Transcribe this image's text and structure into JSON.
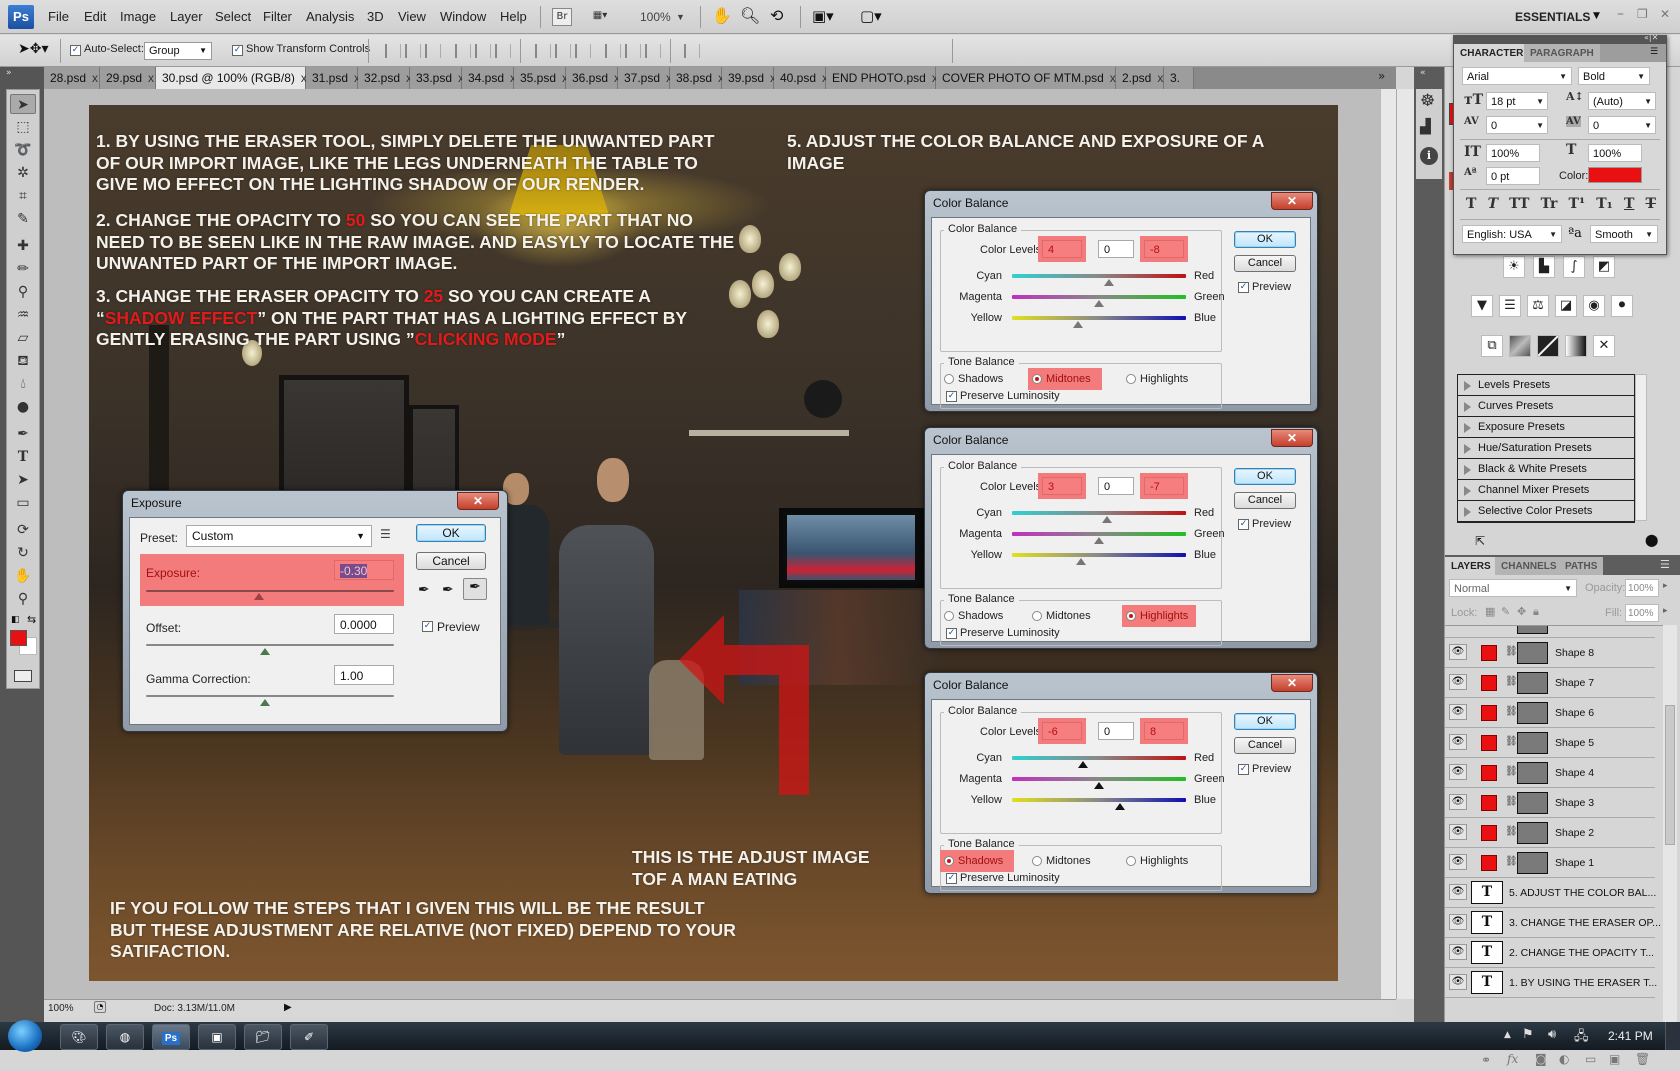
{
  "app": {
    "logo": "Ps",
    "workspace": "ESSENTIALS"
  },
  "menu": [
    "File",
    "Edit",
    "Image",
    "Layer",
    "Select",
    "Filter",
    "Analysis",
    "3D",
    "View",
    "Window",
    "Help"
  ],
  "menubar_tools": {
    "bridge": "Br",
    "zoom_level": "100%"
  },
  "window_controls": {
    "minimize": "–",
    "restore": "❐",
    "close": "✕"
  },
  "options_bar": {
    "auto_select_label": "Auto-Select:",
    "auto_select_checked": true,
    "auto_select_value": "Group",
    "show_transform_label": "Show Transform Controls",
    "show_transform_checked": true
  },
  "tabs": [
    {
      "label": "28.psd",
      "active": false
    },
    {
      "label": "29.psd",
      "active": false
    },
    {
      "label": "30.psd @ 100% (RGB/8)",
      "active": true
    },
    {
      "label": "31.psd",
      "active": false
    },
    {
      "label": "32.psd",
      "active": false
    },
    {
      "label": "33.psd",
      "active": false
    },
    {
      "label": "34.psd",
      "active": false
    },
    {
      "label": "35.psd",
      "active": false
    },
    {
      "label": "36.psd",
      "active": false
    },
    {
      "label": "37.psd",
      "active": false
    },
    {
      "label": "38.psd",
      "active": false
    },
    {
      "label": "39.psd",
      "active": false
    },
    {
      "label": "40.psd",
      "active": false
    },
    {
      "label": "END PHOTO.psd",
      "active": false
    },
    {
      "label": "COVER PHOTO OF MTM.psd",
      "active": false
    },
    {
      "label": "2.psd",
      "active": false
    },
    {
      "label": "3.",
      "active": false
    }
  ],
  "tab_close": "x",
  "tab_overflow": "»",
  "tools": [
    "move",
    "marquee",
    "lasso",
    "magic-wand",
    "crop",
    "eyedropper",
    "healing",
    "brush",
    "clone-stamp",
    "history-brush",
    "eraser",
    "paint-bucket",
    "blur",
    "dodge",
    "pen",
    "type",
    "path-select",
    "rectangle",
    "3d-rotate",
    "3d-orbit",
    "hand",
    "zoom"
  ],
  "colors": {
    "foreground": "#e81010",
    "background": "#ffffff",
    "highlight": "#f47b7b",
    "text_red": "#e11b1b"
  },
  "canvas": {
    "step1": "1. BY USING THE ERASER TOOL, SIMPLY DELETE THE UNWANTED PART\nOF OUR IMPORT IMAGE, LIKE THE LEGS UNDERNEATH THE TABLE TO\nGIVE MO EFFECT ON THE LIGHTING SHADOW OF OUR RENDER.",
    "step2_a": "2. CHANGE THE OPACITY TO ",
    "step2_red": "50",
    "step2_b": " SO YOU CAN SEE THE PART THAT NO\nNEED TO BE SEEN LIKE IN THE RAW IMAGE. AND EASYLY TO LOCATE THE\nUNWANTED PART OF THE IMPORT IMAGE.",
    "step3_a": "3. CHANGE THE ERASER OPACITY TO ",
    "step3_red1": "25",
    "step3_b": " SO YOU CAN CREATE A\n“",
    "step3_red2": "SHADOW EFFECT",
    "step3_c": "” ON THE PART THAT HAS A LIGHTING EFFECT BY\nGENTLY ERASING THE PART USING ”",
    "step3_red3": "CLICKING MODE",
    "step3_d": "”",
    "step5": "5. ADJUST THE COLOR BALANCE AND EXPOSURE OF A\nIMAGE",
    "adjust_note": "THIS IS THE ADJUST IMAGE\nTOF A MAN EATING",
    "result_note": "IF YOU FOLLOW THE STEPS THAT I GIVEN THIS WILL BE THE RESULT\nBUT THESE ADJUSTMENT ARE RELATIVE (NOT FIXED) DEPEND TO YOUR\nSATIFACTION."
  },
  "exposure_dialog": {
    "title": "Exposure",
    "preset_label": "Preset:",
    "preset_value": "Custom",
    "exposure_label": "Exposure:",
    "exposure_value": "-0.30",
    "offset_label": "Offset:",
    "offset_value": "0.0000",
    "gamma_label": "Gamma Correction:",
    "gamma_value": "1.00",
    "ok": "OK",
    "cancel": "Cancel",
    "preview_label": "Preview",
    "preview_checked": true
  },
  "color_balance_dialogs": [
    {
      "title": "Color Balance",
      "group": "Color Balance",
      "levels_label": "Color Levels:",
      "levels": [
        "4",
        "0",
        "-8"
      ],
      "highlighted_levels": [
        0,
        2
      ],
      "sliders": [
        {
          "left": "Cyan",
          "right": "Red",
          "value": 4
        },
        {
          "left": "Magenta",
          "right": "Green",
          "value": 0
        },
        {
          "left": "Yellow",
          "right": "Blue",
          "value": -8
        }
      ],
      "tone_label": "Tone Balance",
      "tones": [
        "Shadows",
        "Midtones",
        "Highlights"
      ],
      "selected_tone": 1,
      "preserve_label": "Preserve Luminosity",
      "preserve_checked": true,
      "ok": "OK",
      "cancel": "Cancel",
      "preview_label": "Preview",
      "preview_checked": true
    },
    {
      "title": "Color Balance",
      "group": "Color Balance",
      "levels_label": "Color Levels:",
      "levels": [
        "3",
        "0",
        "-7"
      ],
      "highlighted_levels": [
        0,
        2
      ],
      "sliders": [
        {
          "left": "Cyan",
          "right": "Red",
          "value": 3
        },
        {
          "left": "Magenta",
          "right": "Green",
          "value": 0
        },
        {
          "left": "Yellow",
          "right": "Blue",
          "value": -7
        }
      ],
      "tone_label": "Tone Balance",
      "tones": [
        "Shadows",
        "Midtones",
        "Highlights"
      ],
      "selected_tone": 2,
      "preserve_label": "Preserve Luminosity",
      "preserve_checked": true,
      "ok": "OK",
      "cancel": "Cancel",
      "preview_label": "Preview",
      "preview_checked": true
    },
    {
      "title": "Color Balance",
      "group": "Color Balance",
      "levels_label": "Color Levels:",
      "levels": [
        "-6",
        "0",
        "8"
      ],
      "highlighted_levels": [
        0,
        2
      ],
      "sliders": [
        {
          "left": "Cyan",
          "right": "Red",
          "value": -6
        },
        {
          "left": "Magenta",
          "right": "Green",
          "value": 0
        },
        {
          "left": "Yellow",
          "right": "Blue",
          "value": 8
        }
      ],
      "tone_label": "Tone Balance",
      "tones": [
        "Shadows",
        "Midtones",
        "Highlights"
      ],
      "selected_tone": 0,
      "preserve_label": "Preserve Luminosity",
      "preserve_checked": true,
      "ok": "OK",
      "cancel": "Cancel",
      "preview_label": "Preview",
      "preview_checked": true
    }
  ],
  "character_panel": {
    "tabs": [
      "CHARACTER",
      "PARAGRAPH"
    ],
    "font_family": "Arial",
    "font_style": "Bold",
    "font_size": "18 pt",
    "leading": "(Auto)",
    "kerning": "0",
    "tracking": "0",
    "vertical_scale": "100%",
    "horizontal_scale": "100%",
    "baseline_shift": "0 pt",
    "color_label": "Color:",
    "color": "#e81010",
    "style_buttons": [
      "T",
      "T",
      "TT",
      "Tr",
      "T¹",
      "T₁",
      "T",
      "T"
    ],
    "language": "English: USA",
    "aa_label": "a",
    "antialias": "Smooth"
  },
  "adjustments_presets": [
    "Levels Presets",
    "Curves Presets",
    "Exposure Presets",
    "Hue/Saturation Presets",
    "Black & White Presets",
    "Channel Mixer Presets",
    "Selective Color Presets"
  ],
  "layers_panel": {
    "tabs": [
      "LAYERS",
      "CHANNELS",
      "PATHS"
    ],
    "blend_mode": "Normal",
    "opacity_label": "Opacity:",
    "opacity": "100%",
    "lock_label": "Lock:",
    "fill_label": "Fill:",
    "fill": "100%",
    "shape_layers": [
      "Shape 8",
      "Shape 7",
      "Shape 6",
      "Shape 5",
      "Shape 4",
      "Shape 3",
      "Shape 2",
      "Shape 1"
    ],
    "text_layers": [
      "5. ADJUST THE COLOR BAL...",
      "3. CHANGE THE ERASER OP...",
      "2. CHANGE THE OPACITY T...",
      "1. BY USING THE ERASER T..."
    ]
  },
  "status": {
    "zoom": "100%",
    "doc": "Doc: 3.13M/11.0M"
  },
  "taskbar": {
    "apps": [
      "paint",
      "chrome",
      "photoshop",
      "photo-viewer",
      "explorer",
      "app"
    ],
    "active_app": "photoshop",
    "clock": "2:41 PM"
  }
}
